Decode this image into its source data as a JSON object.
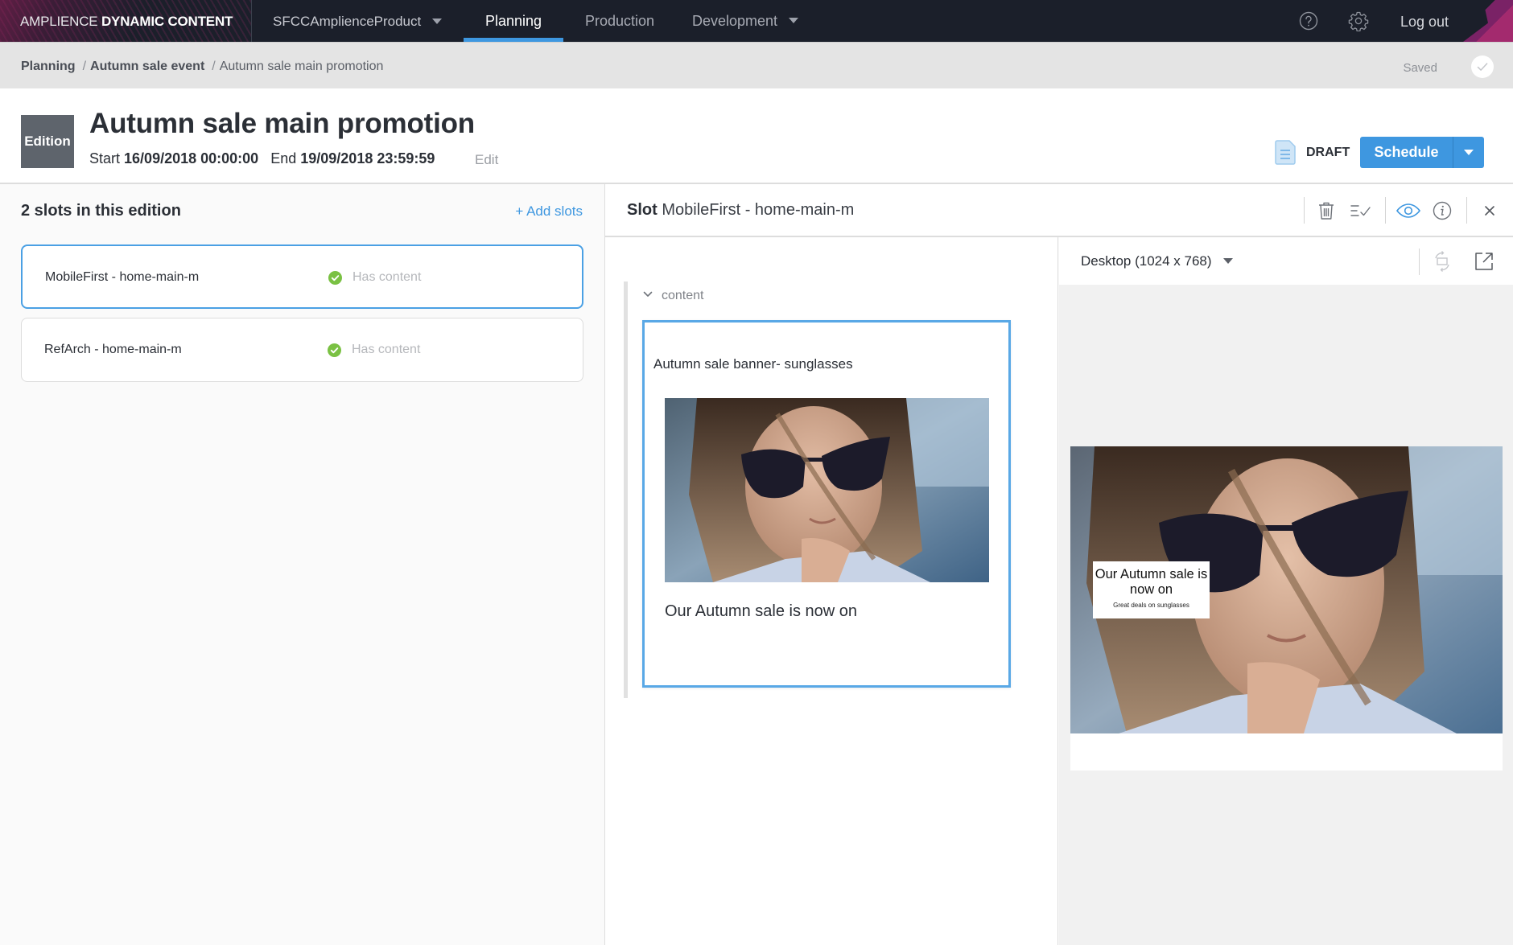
{
  "app": {
    "brand_light": "AMPLIENCE",
    "brand_bold": "DYNAMIC CONTENT",
    "hub": "SFCCAmplienceProduct",
    "nav_tabs": [
      {
        "label": "Planning",
        "active": true
      },
      {
        "label": "Production",
        "active": false
      },
      {
        "label": "Development",
        "active": false,
        "has_dropdown": true
      }
    ],
    "help_icon": "help-circle-icon",
    "settings_icon": "gear-icon",
    "logout_label": "Log out",
    "accent_color": "#3e97e0"
  },
  "breadcrumb": {
    "items": [
      "Planning",
      "Autumn sale event",
      "Autumn sale main promotion"
    ],
    "separator": "/",
    "save_status": "Saved"
  },
  "header": {
    "badge": "Edition",
    "title": "Autumn sale main promotion",
    "start_label": "Start",
    "start_value": "16/09/2018 00:00:00",
    "end_label": "End",
    "end_value": "19/09/2018 23:59:59",
    "edit_label": "Edit",
    "status": "DRAFT",
    "schedule_label": "Schedule"
  },
  "slots_panel": {
    "count_label": "2 slots in this edition",
    "add_label": "+ Add slots",
    "slots": [
      {
        "name": "MobileFirst - home-main-m",
        "status": "Has content",
        "selected": true
      },
      {
        "name": "RefArch - home-main-m",
        "status": "Has content",
        "selected": false
      }
    ],
    "status_color": "#7ac143"
  },
  "slot_editor": {
    "title_prefix": "Slot",
    "title": "MobileFirst - home-main-m",
    "toolbar_icons": [
      "trash-icon",
      "validate-icon",
      "preview-eye-icon",
      "info-icon",
      "close-icon"
    ],
    "section_label": "content",
    "content_item": {
      "title": "Autumn sale banner- sunglasses",
      "image_alt": "Woman wearing sunglasses",
      "caption": "Our Autumn sale is now on"
    }
  },
  "preview": {
    "device": "Desktop (1024 x 768)",
    "icons": [
      "rotate-icon",
      "open-external-icon"
    ],
    "banner_headline": "Our Autumn sale is now on",
    "banner_subtext": "Great deals on sunglasses"
  }
}
